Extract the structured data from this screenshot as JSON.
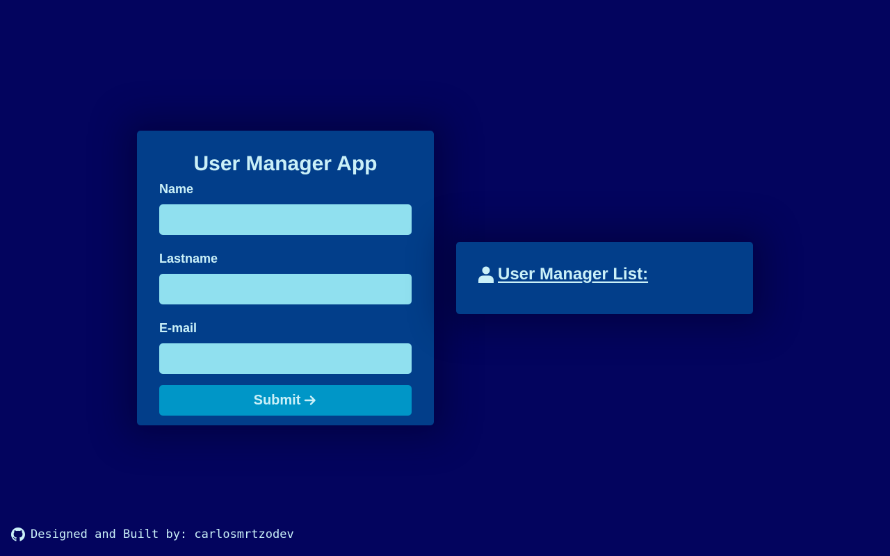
{
  "form": {
    "title": "User Manager App",
    "fields": [
      {
        "label": "Name",
        "value": "",
        "placeholder": ""
      },
      {
        "label": "Lastname",
        "value": "",
        "placeholder": ""
      },
      {
        "label": "E-mail",
        "value": "",
        "placeholder": ""
      }
    ],
    "submit_label": "Submit"
  },
  "list": {
    "heading": "User Manager List:"
  },
  "footer": {
    "text": "Designed and Built by: carlosmrtzodev"
  },
  "colors": {
    "background": "#03045e",
    "card": "#023e8a",
    "input": "#90e0ef",
    "button": "#0096c7",
    "text": "#caf0f8"
  },
  "icons": {
    "submit": "arrow-right-icon",
    "list": "user-icon",
    "footer": "github-icon"
  }
}
